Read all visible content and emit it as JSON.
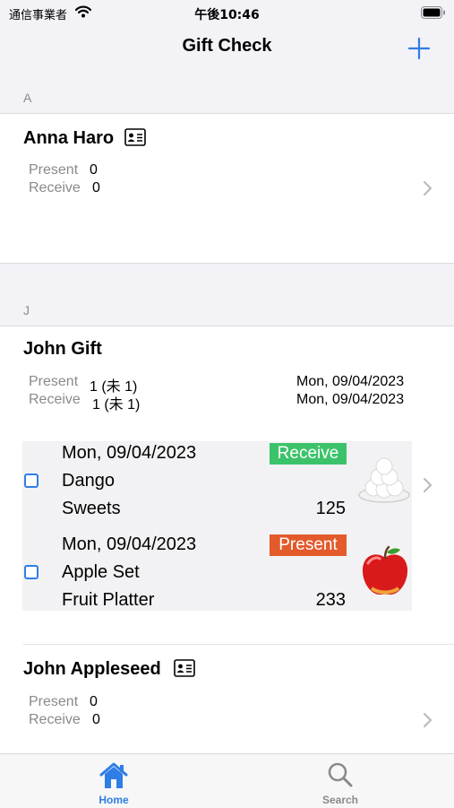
{
  "status_bar": {
    "carrier": "通信事業者",
    "time": "午後10:46"
  },
  "nav": {
    "title": "Gift Check",
    "add_icon": "plus-icon",
    "accent_color": "#2f7ee6"
  },
  "sections": [
    {
      "header": "A",
      "people": [
        {
          "name": "Anna Haro",
          "has_contact_card": true,
          "present_label": "Present",
          "present_value": "0",
          "receive_label": "Receive",
          "receive_value": "0"
        }
      ]
    },
    {
      "header": "J",
      "people": [
        {
          "name": "John Gift",
          "has_contact_card": false,
          "present_label": "Present",
          "present_value": "1 (未 1)",
          "present_date": "Mon, 09/04/2023",
          "receive_label": "Receive",
          "receive_value": "1 (未 1)",
          "receive_date": "Mon, 09/04/2023",
          "gifts": [
            {
              "date": "Mon, 09/04/2023",
              "type": "Receive",
              "type_color": "#3cc36a",
              "name": "Dango",
              "category": "Sweets",
              "amount": "125",
              "image_icon": "dango-icon",
              "checked": false
            },
            {
              "date": "Mon, 09/04/2023",
              "type": "Present",
              "type_color": "#e35a2b",
              "name": "Apple Set",
              "category": "Fruit Platter",
              "amount": "233",
              "image_icon": "apple-icon",
              "checked": false
            }
          ]
        },
        {
          "name": "John Appleseed",
          "has_contact_card": true,
          "present_label": "Present",
          "present_value": "0",
          "receive_label": "Receive",
          "receive_value": "0"
        }
      ]
    }
  ],
  "tab_bar": {
    "tabs": [
      {
        "label": "Home",
        "icon": "house-icon",
        "selected": true,
        "color": "#2f7ee6"
      },
      {
        "label": "Search",
        "icon": "magnifier-icon",
        "selected": false,
        "color": "#8a8a8e"
      }
    ]
  }
}
